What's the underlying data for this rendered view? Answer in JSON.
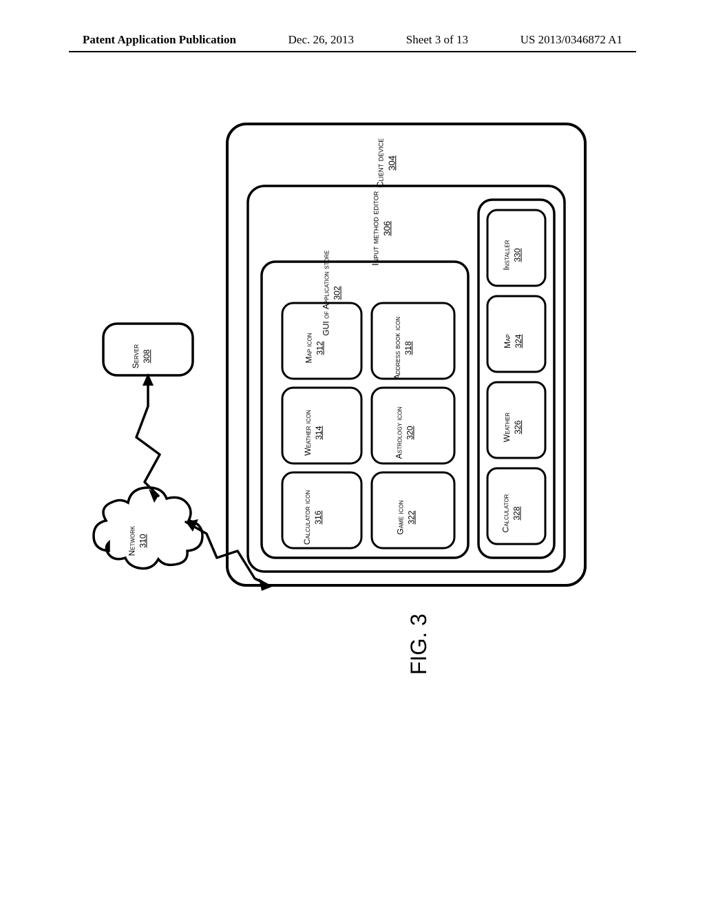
{
  "header": {
    "publication_label": "Patent Application Publication",
    "date": "Dec. 26, 2013",
    "sheet": "Sheet 3 of 13",
    "pubnum": "US 2013/0346872 A1"
  },
  "figure_label": "FIG. 3",
  "boxes": {
    "client_device": {
      "label": "Client device",
      "ref": "304"
    },
    "ime": {
      "label": "Input method editor",
      "ref": "306"
    },
    "gui_store": {
      "label": "GUI of Application store",
      "ref": "302"
    },
    "map_icon": {
      "label": "Map icon",
      "ref": "312"
    },
    "weather_icon": {
      "label": "Weather icon",
      "ref": "314"
    },
    "calc_icon": {
      "label": "Calculator icon",
      "ref": "316"
    },
    "address_icon": {
      "label": "Address book icon",
      "ref": "318"
    },
    "astro_icon": {
      "label": "Astrology icon",
      "ref": "320"
    },
    "game_icon": {
      "label": "Game icon",
      "ref": "322"
    },
    "installer": {
      "label": "Installer",
      "ref": "330"
    },
    "map": {
      "label": "Map",
      "ref": "324"
    },
    "weather": {
      "label": "Weather",
      "ref": "326"
    },
    "calculator": {
      "label": "Calculator",
      "ref": "328"
    },
    "server": {
      "label": "Server",
      "ref": "308"
    },
    "network": {
      "label": "Network",
      "ref": "310"
    }
  }
}
